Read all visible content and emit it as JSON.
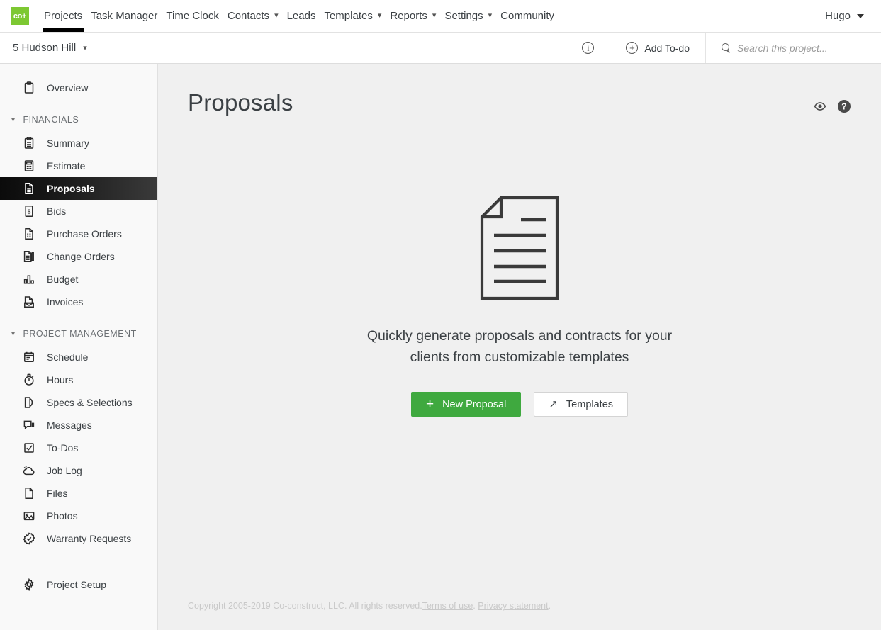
{
  "topnav": {
    "logo_text": "co+",
    "items": [
      {
        "label": "Projects",
        "caret": "none",
        "active": true
      },
      {
        "label": "Task Manager",
        "caret": "none",
        "active": false
      },
      {
        "label": "Time Clock",
        "caret": "none",
        "active": false
      },
      {
        "label": "Contacts",
        "caret": "chevron",
        "active": false
      },
      {
        "label": "Leads",
        "caret": "none",
        "active": false
      },
      {
        "label": "Templates",
        "caret": "chevron",
        "active": false
      },
      {
        "label": "Reports",
        "caret": "chevron",
        "active": false
      },
      {
        "label": "Settings",
        "caret": "chevron",
        "active": false
      },
      {
        "label": "Community",
        "caret": "none",
        "active": false
      }
    ],
    "user_label": "Hugo"
  },
  "projectbar": {
    "project_name": "5 Hudson Hill",
    "info_icon": "circle-info-icon",
    "add_todo_label": "Add To-do",
    "search_placeholder": "Search this project..."
  },
  "sidebar": {
    "overview": {
      "label": "Overview",
      "icon": "clipboard-icon"
    },
    "sections": [
      {
        "title": "FINANCIALS",
        "items": [
          {
            "label": "Summary",
            "icon": "clipboard-list-icon",
            "selected": false
          },
          {
            "label": "Estimate",
            "icon": "calculator-icon",
            "selected": false
          },
          {
            "label": "Proposals",
            "icon": "document-icon",
            "selected": true
          },
          {
            "label": "Bids",
            "icon": "dollar-doc-icon",
            "selected": false
          },
          {
            "label": "Purchase Orders",
            "icon": "grid-doc-icon",
            "selected": false
          },
          {
            "label": "Change Orders",
            "icon": "docs-stack-icon",
            "selected": false
          },
          {
            "label": "Budget",
            "icon": "bar-chart-icon",
            "selected": false
          },
          {
            "label": "Invoices",
            "icon": "invoice-icon",
            "selected": false
          }
        ]
      },
      {
        "title": "PROJECT MANAGEMENT",
        "items": [
          {
            "label": "Schedule",
            "icon": "calendar-icon",
            "selected": false
          },
          {
            "label": "Hours",
            "icon": "stopwatch-icon",
            "selected": false
          },
          {
            "label": "Specs & Selections",
            "icon": "spec-page-icon",
            "selected": false
          },
          {
            "label": "Messages",
            "icon": "chat-bubble-icon",
            "selected": false
          },
          {
            "label": "To-Dos",
            "icon": "checkbox-icon",
            "selected": false
          },
          {
            "label": "Job Log",
            "icon": "weather-cloud-icon",
            "selected": false
          },
          {
            "label": "Files",
            "icon": "file-icon",
            "selected": false
          },
          {
            "label": "Photos",
            "icon": "photo-icon",
            "selected": false
          },
          {
            "label": "Warranty Requests",
            "icon": "badge-check-icon",
            "selected": false
          }
        ]
      }
    ],
    "project_setup": {
      "label": "Project Setup",
      "icon": "gear-icon"
    }
  },
  "main": {
    "title": "Proposals",
    "head_icons": [
      {
        "name": "eye-icon"
      },
      {
        "name": "help-circle-icon"
      }
    ],
    "empty_state": {
      "illustration": "document-illustration",
      "message": "Quickly generate proposals and contracts for your clients from customizable templates",
      "primary_button": {
        "label": "New Proposal",
        "icon": "plus-icon"
      },
      "secondary_button": {
        "label": "Templates",
        "icon": "arrow-up-right-icon"
      }
    }
  },
  "footer": {
    "copyright": "Copyright 2005-2019 Co-construct, LLC. All rights reserved.",
    "terms_link": "Terms of use",
    "separator": ".",
    "privacy_link": "Privacy statement",
    "period": "."
  },
  "colors": {
    "brand_green": "#7dc832",
    "button_green": "#3fa93f",
    "active_underline": "#000000",
    "sidebar_bg": "#f9f9f9",
    "content_bg": "#f0f0f0",
    "text": "#3b4044"
  }
}
